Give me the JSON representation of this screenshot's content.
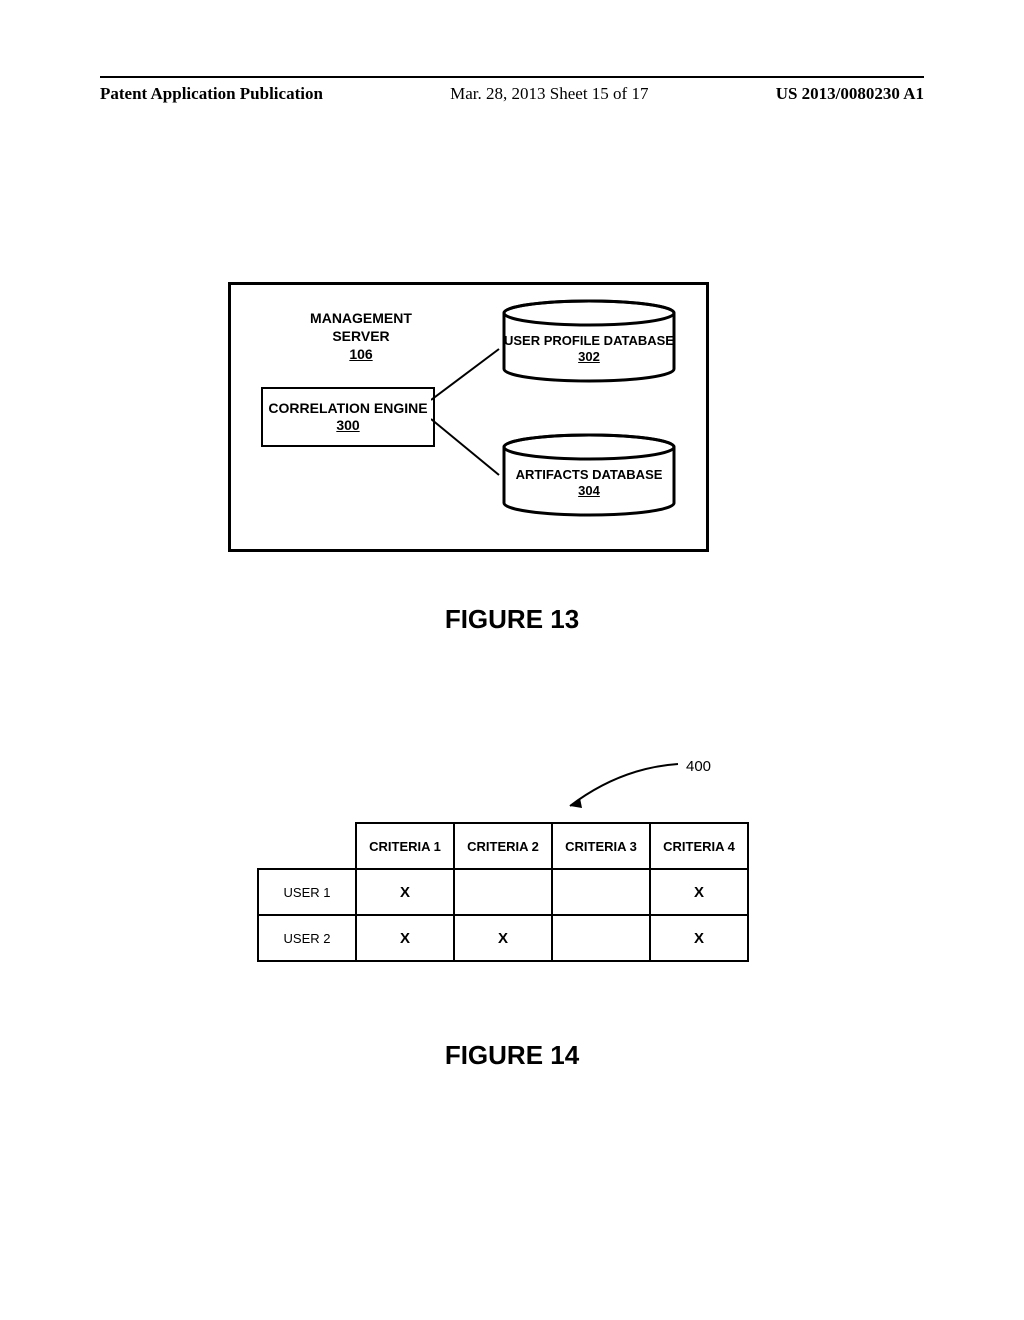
{
  "header": {
    "left": "Patent Application Publication",
    "middle": "Mar. 28, 2013  Sheet 15 of 17",
    "right": "US 2013/0080230 A1"
  },
  "fig13": {
    "management_title": "MANAGEMENT SERVER",
    "management_num": "106",
    "correlation_title": "CORRELATION ENGINE",
    "correlation_num": "300",
    "db1_title": "USER PROFILE DATABASE",
    "db1_num": "302",
    "db2_title": "ARTIFACTS DATABASE",
    "db2_num": "304",
    "caption": "FIGURE 13"
  },
  "fig14": {
    "lead_label": "400",
    "caption": "FIGURE 14",
    "table": {
      "headers": [
        "CRITERIA 1",
        "CRITERIA 2",
        "CRITERIA 3",
        "CRITERIA 4"
      ],
      "rows": [
        {
          "label": "USER 1",
          "cells": [
            "X",
            "",
            "",
            "X"
          ]
        },
        {
          "label": "USER 2",
          "cells": [
            "X",
            "X",
            "",
            "X"
          ]
        }
      ]
    }
  },
  "chart_data": {
    "type": "table",
    "title": "User criteria matrix (Figure 14)",
    "columns": [
      "CRITERIA 1",
      "CRITERIA 2",
      "CRITERIA 3",
      "CRITERIA 4"
    ],
    "rows": [
      "USER 1",
      "USER 2"
    ],
    "matrix": [
      [
        true,
        false,
        false,
        true
      ],
      [
        true,
        true,
        false,
        true
      ]
    ]
  }
}
